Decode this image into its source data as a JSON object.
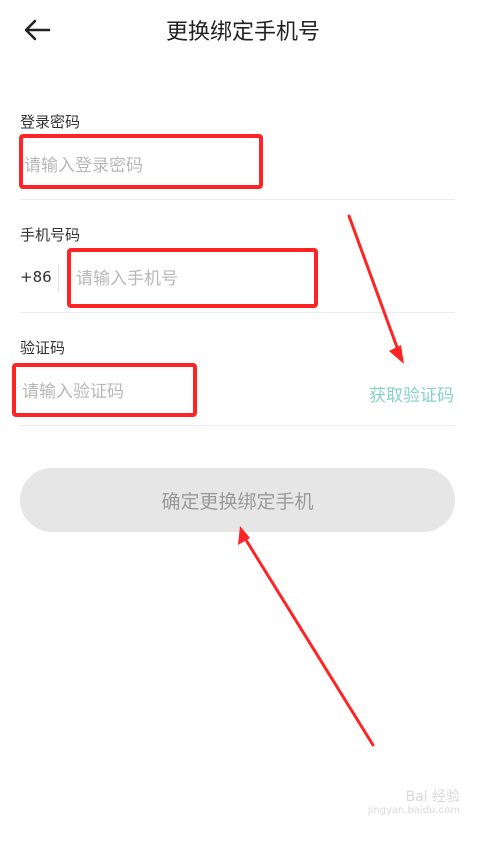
{
  "header": {
    "title": "更换绑定手机号",
    "back_icon": "arrow-left-icon"
  },
  "form": {
    "password": {
      "label": "登录密码",
      "placeholder": "请输入登录密码"
    },
    "phone": {
      "label": "手机号码",
      "country_code": "+86",
      "placeholder": "请输入手机号"
    },
    "code": {
      "label": "验证码",
      "placeholder": "请输入验证码",
      "get_code_label": "获取验证码"
    }
  },
  "confirm_label": "确定更换绑定手机",
  "watermark": {
    "text": "Bai 经验",
    "url": "jingyan.baidu.com"
  },
  "colors": {
    "annotation": "#ff2424",
    "get_code": "#86d2c5",
    "button_bg": "#e6e6e6"
  }
}
